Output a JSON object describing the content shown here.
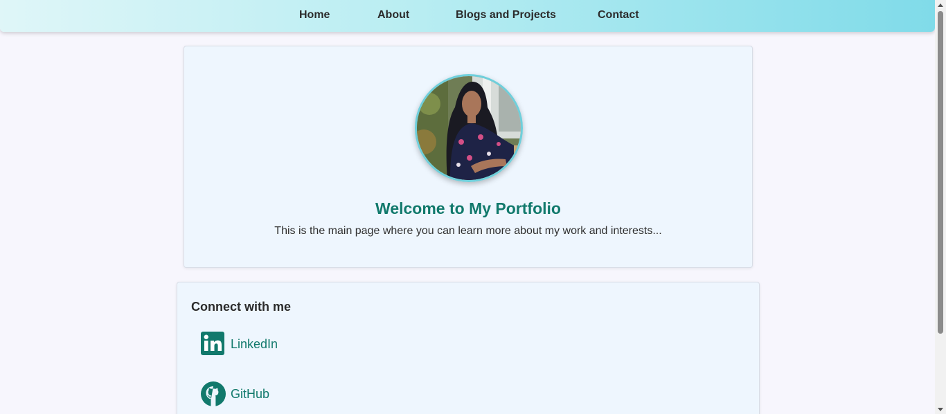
{
  "nav": {
    "items": [
      {
        "label": "Home"
      },
      {
        "label": "About"
      },
      {
        "label": "Blogs and Projects"
      },
      {
        "label": "Contact"
      }
    ]
  },
  "hero": {
    "title": "Welcome to My Portfolio",
    "subtitle": "This is the main page where you can learn more about my work and interests..."
  },
  "connect": {
    "title": "Connect with me",
    "links": [
      {
        "label": "LinkedIn",
        "icon": "linkedin-icon"
      },
      {
        "label": "GitHub",
        "icon": "github-icon"
      }
    ]
  },
  "colors": {
    "accent": "#11796c",
    "nav_gradient_start": "#dff6f8",
    "nav_gradient_end": "#80dbe9",
    "card_bg": "#eef6fe",
    "avatar_border": "#6fcfdb"
  }
}
